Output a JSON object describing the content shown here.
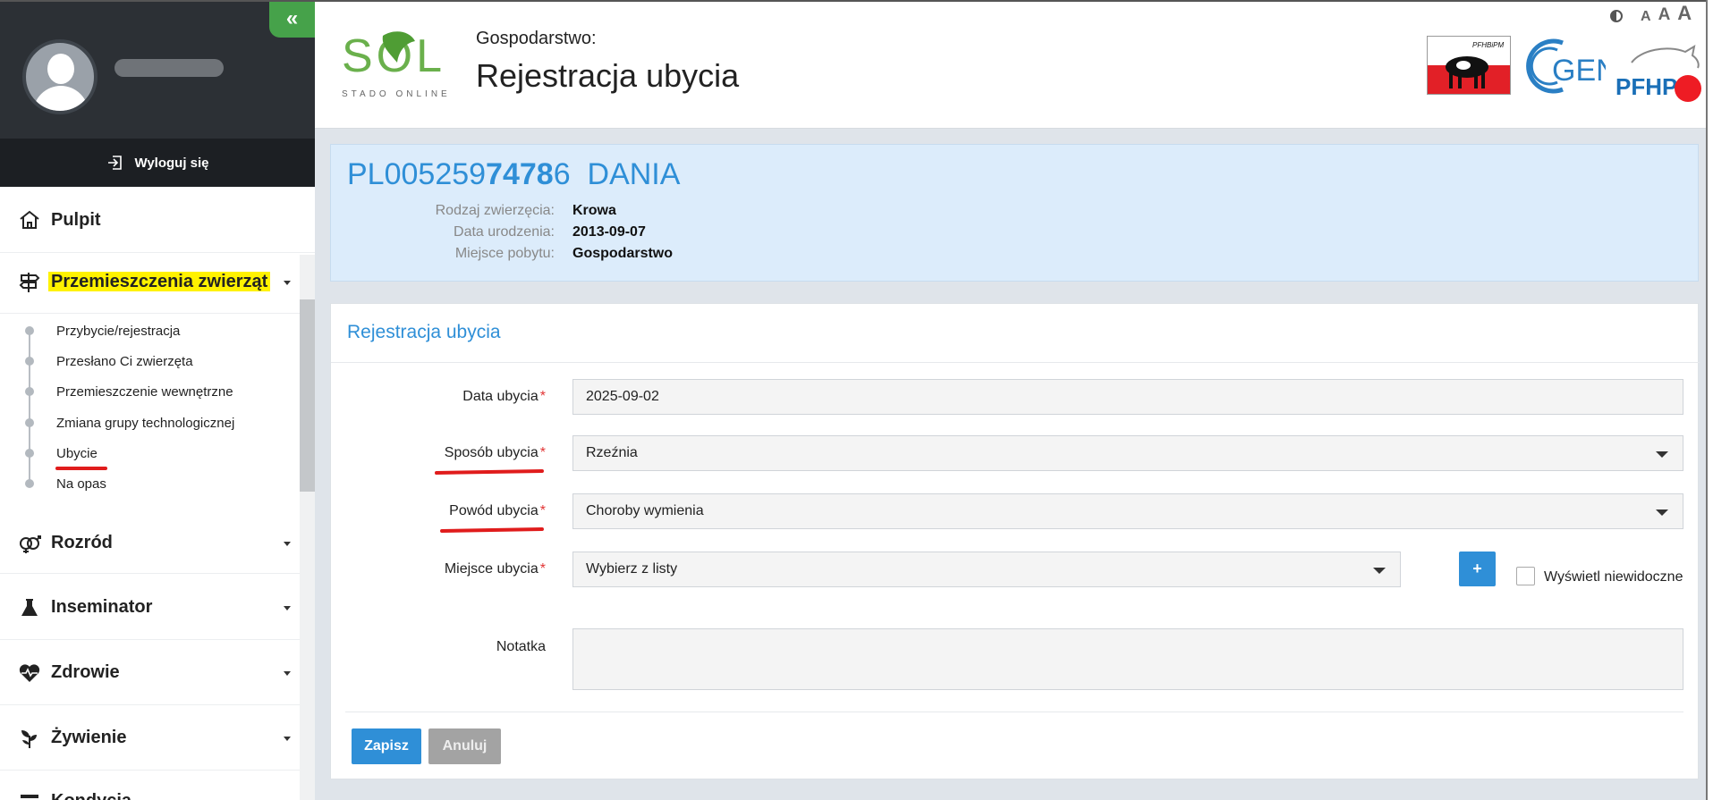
{
  "sidebar": {
    "logout_label": "Wyloguj się",
    "items": [
      {
        "label": "Pulpit",
        "icon": "home-icon"
      },
      {
        "label": "Przemieszczenia zwierząt",
        "icon": "signpost-icon"
      },
      {
        "label": "Rozród",
        "icon": "gender-icon"
      },
      {
        "label": "Inseminator",
        "icon": "flask-icon"
      },
      {
        "label": "Zdrowie",
        "icon": "heart-pulse-icon"
      },
      {
        "label": "Żywienie",
        "icon": "plant-icon"
      },
      {
        "label": "Kondycja",
        "icon": "list-icon"
      }
    ],
    "submenu": [
      "Przybycie/rejestracja",
      "Przesłano Ci zwierzęta",
      "Przemieszczenie wewnętrzne",
      "Zmiana grupy technologicznej",
      "Ubycie",
      "Na opas"
    ]
  },
  "header": {
    "logo_text": "SOL",
    "logo_subtext": "STADO ONLINE",
    "farm_label": "Gospodarstwo:",
    "page_title": "Rejestracja ubycia",
    "logo_pfhb_text": "PFHBiPM",
    "logo_cgen_text": "GEN",
    "logo_pfhp_text": "PFHP",
    "font_sizes": [
      "A",
      "A",
      "A"
    ]
  },
  "animal": {
    "id_prefix": "PL005259",
    "id_bold": "7478",
    "id_suffix": "6",
    "name": "DANIA",
    "attributes": [
      {
        "label": "Rodzaj zwierzęcia:",
        "value": "Krowa"
      },
      {
        "label": "Data urodzenia:",
        "value": "2013-09-07"
      },
      {
        "label": "Miejsce pobytu:",
        "value": "Gospodarstwo"
      }
    ]
  },
  "form": {
    "title": "Rejestracja ubycia",
    "date_label": "Data ubycia",
    "date_value": "2025-09-02",
    "method_label": "Sposób ubycia",
    "method_value": "Rzeźnia",
    "reason_label": "Powód ubycia",
    "reason_value": "Choroby wymienia",
    "place_label": "Miejsce ubycia",
    "place_placeholder": "Wybierz z listy",
    "add_button": "+",
    "show_hidden_label": "Wyświetl niewidoczne",
    "note_label": "Notatka",
    "required_mark": "*",
    "save_button": "Zapisz",
    "cancel_button": "Anuluj"
  },
  "colors": {
    "accent": "#2f8fd7",
    "highlight": "#fff200",
    "annotation": "#e01c1c",
    "brand_green": "#46a24a"
  }
}
